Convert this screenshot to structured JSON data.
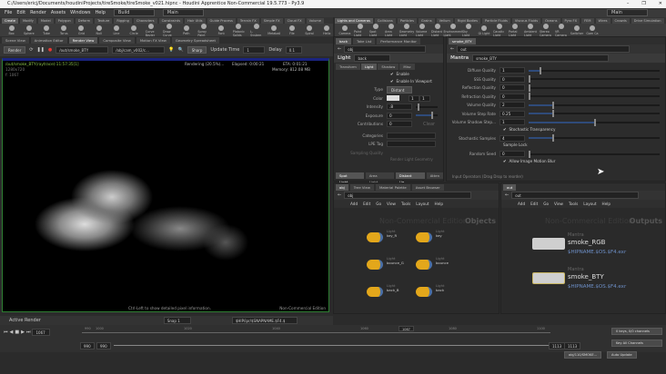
{
  "window": {
    "title": "C:/Users/ericj/Documents/houdiniProjects/tireSmoke/tireSmoke_v021.hipnc - Houdini Apprentice Non-Commercial 19.5.773 - Py3.9",
    "min": "–",
    "max": "❐",
    "close": "✕"
  },
  "menu": {
    "items": [
      "File",
      "Edit",
      "Render",
      "Assets",
      "Windows",
      "Help"
    ],
    "desktop": "Build",
    "desktop2": "Main",
    "desktop_right": "Main"
  },
  "shelf_left": {
    "tabs": [
      "Create",
      "Modify",
      "Model",
      "Polygon",
      "Deform",
      "Texture",
      "Rigging",
      "Characters",
      "Constraints",
      "Hair Utils",
      "Guide Process",
      "Terrain FX",
      "Simple FX",
      "Cloud FX",
      "Volume"
    ],
    "tools": [
      "Box",
      "Sphere",
      "Tube",
      "Torus",
      "Grid",
      "Null",
      "Line",
      "Circle",
      "Curve Bezier",
      "Draw Curve",
      "Path",
      "Spray Paint",
      "Font",
      "Platonic Solids",
      "L-System",
      "Metaball",
      "File",
      "Spiral",
      "Helix"
    ]
  },
  "shelf_right": {
    "tabs": [
      "Lights and Cameras",
      "Collisions",
      "Particles",
      "Grains",
      "Vellum",
      "Rigid Bodies",
      "Particle Fluids",
      "Viscous Fluids",
      "Oceans",
      "Pyro FX",
      "FEM",
      "Wires",
      "Crowds",
      "Drive Simulation"
    ],
    "tools": [
      "Camera",
      "Point Light",
      "Spot Light",
      "Area Light",
      "Geometry Light",
      "Volume Light",
      "Distant Light",
      "Environment Light",
      "Sky Light",
      "GI Light",
      "Caustic Light",
      "Portal Light",
      "Ambient Light",
      "Stereo Camera",
      "VR Camera",
      "Switcher",
      "Gam Ca"
    ]
  },
  "left_tabs": [
    "Scene View",
    "Animation Editor",
    "Render View",
    "Composite View",
    "Motion FX View",
    "Geometry Spreadsheet"
  ],
  "render_toolbar": {
    "render": "Render",
    "rop": "/out/smoke_BTY",
    "camera": "/obj/cam_v002/c...",
    "preview": "Sharp",
    "update_label": "Update Time",
    "update_val": "1",
    "delay_label": "Delay",
    "delay_val": "0.1"
  },
  "viewport": {
    "path": "/out/smoke_BTY(raytrace)-11:57:35[1]",
    "res": "1280x720",
    "frame": "f: 1067",
    "status": "Rendering (20.5%)...",
    "elapsed": "Elapsed: 0:00:21",
    "eta": "ETA: 0:01:21",
    "memory": "Memory:  812.08 MB",
    "hint": "Ctrl-Left to show detailed pixel information.",
    "edition": "Non-Commercial Edition"
  },
  "vp_bottom": {
    "active": "Active Render",
    "snap": "Snap 1",
    "output": "$HIP/ipr/$SNAPNAME.$F4.$"
  },
  "light_pane": {
    "tabs": [
      "back",
      "Take List",
      "Performance Monitor"
    ],
    "path": "obj",
    "type_label": "Light",
    "name": "back",
    "subtabs": [
      "Transform",
      "Light",
      "Shadow",
      "Misc"
    ],
    "enable": "Enable",
    "enable_vp": "Enable In Viewport",
    "type": "Type",
    "type_val": "Distant",
    "color": "Color",
    "color_vals": [
      "1",
      "1"
    ],
    "intensity": "Intensity",
    "intensity_val": ".8",
    "exposure": "Exposure",
    "exposure_val": "0",
    "contrib": "Contributions",
    "contrib_val": "0",
    "clear": "Clear",
    "categories": "Categories",
    "lpe": "LPE Tag",
    "sampling": "Sampling Quality",
    "render_geo": "Render Light Geometry",
    "presets": [
      "Spot Light...",
      "Area Light...",
      "Distant Lig...",
      "Atten"
    ]
  },
  "mantra_pane": {
    "tab": "smoke_BTY",
    "path": "out",
    "type_label": "Mantra",
    "name": "smoke_BTY",
    "params": [
      {
        "label": "Diffuse Quality",
        "value": "1",
        "fill": 0.08
      },
      {
        "label": "SSS Quality",
        "value": "0",
        "fill": 0
      },
      {
        "label": "Reflection Quality",
        "value": "0",
        "fill": 0
      },
      {
        "label": "Refraction Quality",
        "value": "0",
        "fill": 0
      },
      {
        "label": "Volume Quality",
        "value": "2",
        "fill": 0.18
      },
      {
        "label": "Volume Step Rate",
        "value": "0.25",
        "fill": 0.18
      },
      {
        "label": "Volume Shadow Step...",
        "value": "1",
        "fill": 0.5
      }
    ],
    "stoch_trans": "Stochastic Transparency",
    "stoch_samples": "Stochastic Samples",
    "stoch_val": "4",
    "sample_lock": "Sample Lock",
    "seed": "Random Seed",
    "seed_val": "0",
    "motion_blur": "Allow Image Motion Blur",
    "input_ops": "Input Operators (Drag Drop to reorder)"
  },
  "net_left": {
    "tabs": [
      "obj",
      "Tree View",
      "Material Palette",
      "Asset Browser"
    ],
    "path": "obj",
    "menu": [
      "Add",
      "Edit",
      "Go",
      "View",
      "Tools",
      "Layout",
      "Help"
    ],
    "watermark": "Non-Commercial Edition",
    "context": "Objects",
    "nodes": [
      {
        "type": "Light",
        "name": "key_R"
      },
      {
        "type": "Light",
        "name": "key"
      },
      {
        "type": "Light",
        "name": "bounce_G"
      },
      {
        "type": "Light",
        "name": "bounce"
      },
      {
        "type": "Light",
        "name": "back_B"
      },
      {
        "type": "Light",
        "name": "back"
      }
    ]
  },
  "net_right": {
    "tabs": [
      "out"
    ],
    "path": "out",
    "menu": [
      "Add",
      "Edit",
      "Go",
      "View",
      "Tools",
      "Layout",
      "Help"
    ],
    "watermark": "Non-Commercial Edition",
    "context": "Outputs",
    "nodes": [
      {
        "type": "Mantra",
        "name": "smoke_RGB",
        "out": "$HIPNAME.$OS.$F4.exr"
      },
      {
        "type": "Mantra",
        "name": "smoke_BTY",
        "out": "$HIPNAME.$OS.$F4.exr"
      }
    ]
  },
  "timeline": {
    "frame": "1067",
    "ticks": [
      "990",
      "1000",
      "1020",
      "1040",
      "1060",
      "1080",
      "1100"
    ],
    "marker": "1067",
    "start": "990",
    "start2": "990",
    "end": "1113",
    "end2": "1113",
    "keys": "0 keys, 0/0 channels",
    "key_all": "Key All Channels",
    "status": "obj/110/SMOKE...",
    "auto_update": "Auto Update"
  },
  "colors": {
    "accent": "#4a6fa5",
    "light_node": "#e3a71b",
    "border_green": "#2e7d32"
  }
}
